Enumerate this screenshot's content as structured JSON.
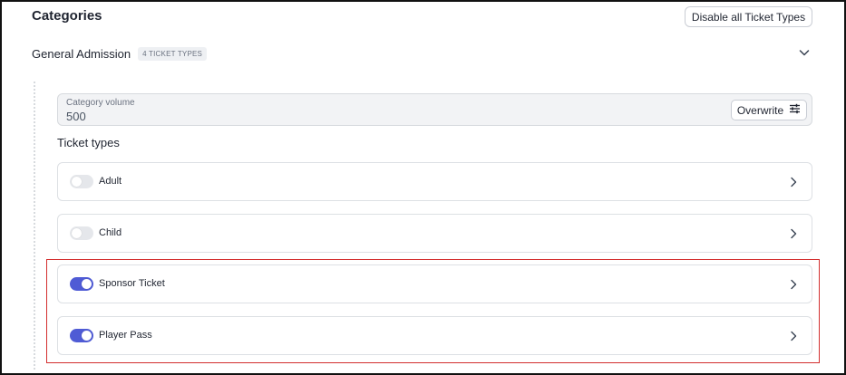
{
  "section": {
    "title": "Categories",
    "disable_button_label": "Disable all Ticket Types"
  },
  "group": {
    "name": "General Admission",
    "badge": "4 TICKET TYPES",
    "expanded": true
  },
  "volume": {
    "label": "Category volume",
    "value": "500",
    "overwrite_label": "Overwrite"
  },
  "ticket_types": {
    "title": "Ticket types",
    "items": [
      {
        "label": "Adult",
        "enabled": false
      },
      {
        "label": "Child",
        "enabled": false
      },
      {
        "label": "Sponsor Ticket",
        "enabled": true
      },
      {
        "label": "Player Pass",
        "enabled": true
      }
    ]
  },
  "colors": {
    "toggle_on": "#4f5bd5",
    "toggle_off": "#e5e7eb",
    "highlight": "#d32f2f"
  }
}
